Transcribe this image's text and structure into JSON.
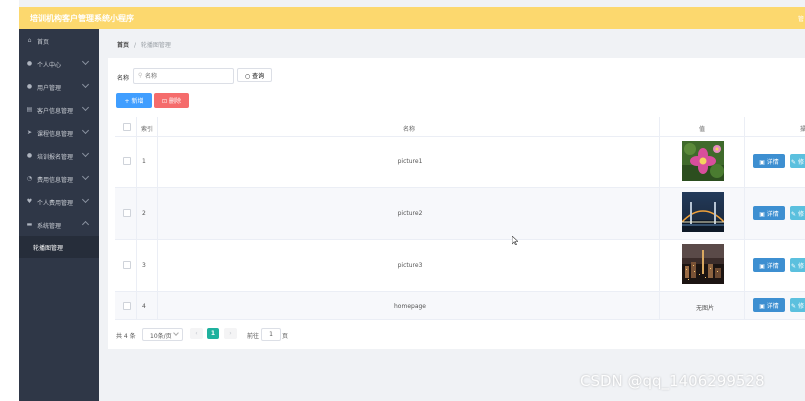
{
  "app": {
    "title": "培训机构客户管理系统小程序",
    "header_right": "管"
  },
  "sidebar": {
    "items": [
      {
        "label": "首页",
        "icon": "home-icon",
        "glyph": "⌂"
      },
      {
        "label": "个人中心",
        "icon": "user-icon",
        "glyph": "●"
      },
      {
        "label": "用户管理",
        "icon": "user-icon",
        "glyph": "●"
      },
      {
        "label": "客户信息管理",
        "icon": "list-icon",
        "glyph": "▤"
      },
      {
        "label": "课程信息管理",
        "icon": "send-icon",
        "glyph": "➤"
      },
      {
        "label": "培训报名管理",
        "icon": "user-icon",
        "glyph": "●"
      },
      {
        "label": "费用信息管理",
        "icon": "clock-icon",
        "glyph": "◔"
      },
      {
        "label": "个人费用管理",
        "icon": "shield-icon",
        "glyph": "♥"
      },
      {
        "label": "系统管理",
        "icon": "system-icon",
        "glyph": "▬"
      }
    ],
    "sub_items": [
      {
        "label": "轮播图管理"
      }
    ]
  },
  "breadcrumb": {
    "home": "首页",
    "separator": "/",
    "current": "轮播图管理"
  },
  "search": {
    "label": "名称",
    "placeholder": "名称",
    "button": "查询"
  },
  "actions": {
    "add": "+ 新增",
    "delete": "删除"
  },
  "table": {
    "headers": [
      "索引",
      "名称",
      "值",
      "操"
    ],
    "rows": [
      {
        "index": "1",
        "name": "picture1",
        "value": "image",
        "image": "flower"
      },
      {
        "index": "2",
        "name": "picture2",
        "value": "image",
        "image": "bridge"
      },
      {
        "index": "3",
        "name": "picture3",
        "value": "image",
        "image": "city"
      },
      {
        "index": "4",
        "name": "homepage",
        "value": "无图片",
        "image": "none"
      }
    ],
    "detail_label": "详情",
    "edit_label": "修"
  },
  "pagination": {
    "total": "共 4 条",
    "page_size": "10条/页",
    "current_page": "1",
    "goto_label": "前往",
    "goto_value": "1",
    "goto_unit": "页"
  },
  "watermark": "CSDN @qq_1406299528"
}
